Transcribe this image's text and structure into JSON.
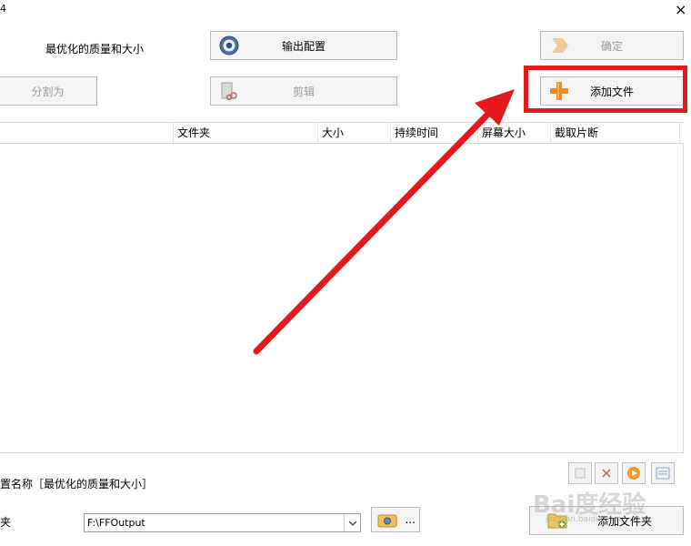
{
  "window": {
    "corner_glyph": "4",
    "close_glyph": "×"
  },
  "labels": {
    "quality": "最优化的质量和大小",
    "profile_name": "置名称［最优化的质量和大小］",
    "output_folder": "夹"
  },
  "buttons": {
    "output_config": "输出配置",
    "ok": "确定",
    "split": "分割为",
    "clip": "剪辑",
    "add_file": "添加文件",
    "add_folder": "添加文件夹",
    "browse_ellipsis": "..."
  },
  "table": {
    "columns": [
      "文件夹",
      "大小",
      "持续时间",
      "屏幕大小",
      "截取片断"
    ]
  },
  "output": {
    "path": "F:\\FFOutput"
  },
  "watermark": {
    "text": "Bai度经验",
    "sub": "jingyan.baidu.com"
  },
  "colors": {
    "highlight": "#e5191b",
    "arrow": "#e5191b"
  }
}
